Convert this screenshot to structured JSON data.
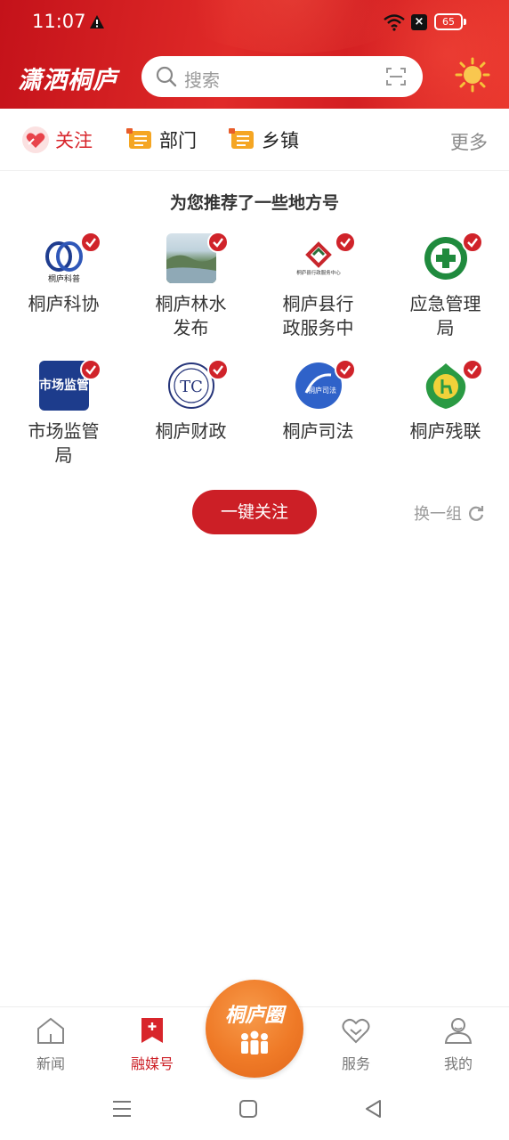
{
  "status_bar": {
    "time": "11:07",
    "battery": "65"
  },
  "header": {
    "app_name": "潇洒桐庐",
    "search_placeholder": "搜索"
  },
  "channels": {
    "follow": "关注",
    "dept": "部门",
    "town": "乡镇",
    "more": "更多"
  },
  "recommend": {
    "title": "为您推荐了一些地方号",
    "accounts": [
      {
        "name": "桐庐科协",
        "logo_text": "桐庐科普"
      },
      {
        "name": "桐庐林水发布"
      },
      {
        "name": "桐庐县行政服务中",
        "logo_text": "桐庐县行政服务中心"
      },
      {
        "name": "应急管理局"
      },
      {
        "name": "市场监管局",
        "logo_text": "市场监管"
      },
      {
        "name": "桐庐财政",
        "logo_text": "TC"
      },
      {
        "name": "桐庐司法",
        "logo_text": "桐庐司法"
      },
      {
        "name": "桐庐残联"
      }
    ],
    "follow_all": "一键关注",
    "refresh": "换一组"
  },
  "tabbar": {
    "news": "新闻",
    "media": "融媒号",
    "center": "桐庐圈",
    "service": "服务",
    "mine": "我的"
  },
  "colors": {
    "brand_red": "#cc1f26",
    "accent_orange": "#ef7a27"
  }
}
